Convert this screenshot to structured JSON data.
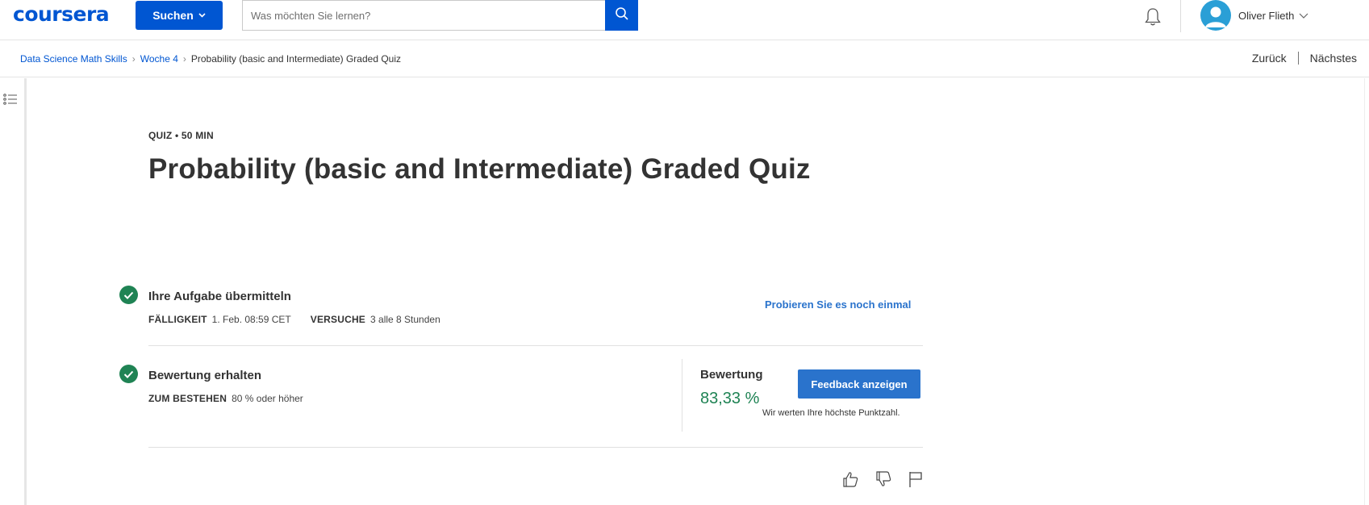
{
  "header": {
    "logo_text": "coursera",
    "browse_label": "Suchen",
    "search_placeholder": "Was möchten Sie lernen?",
    "user_name": "Oliver Flieth",
    "icons": [
      "search-icon",
      "bell-icon",
      "avatar-icon",
      "chevron-down-icon"
    ],
    "brand_color": "#0056d2"
  },
  "breadcrumb": {
    "items": [
      "Data Science Math Skills",
      "Woche 4",
      "Probability (basic and Intermediate) Graded Quiz"
    ],
    "prev_label": "Zurück",
    "next_label": "Nächstes"
  },
  "quiz": {
    "kicker": "QUIZ • 50 MIN",
    "title": "Probability (basic and Intermediate) Graded Quiz"
  },
  "submission": {
    "title": "Ihre Aufgabe übermitteln",
    "due_label": "FÄLLIGKEIT",
    "due_value": "1. Feb. 08:59 CET",
    "attempts_label": "VERSUCHE",
    "attempts_value": "3 alle 8 Stunden",
    "retry_label": "Probieren Sie es noch einmal"
  },
  "grade": {
    "title": "Bewertung erhalten",
    "pass_label": "ZUM BESTEHEN",
    "pass_value": "80 % oder höher",
    "grade_label": "Bewertung",
    "grade_value": "83,33 %",
    "feedback_button": "Feedback anzeigen",
    "note": "Wir werten Ihre höchste Punktzahl.",
    "success_color": "#1f8354"
  },
  "feedback_icons": [
    "thumbs-up-icon",
    "thumbs-down-icon",
    "flag-icon"
  ]
}
